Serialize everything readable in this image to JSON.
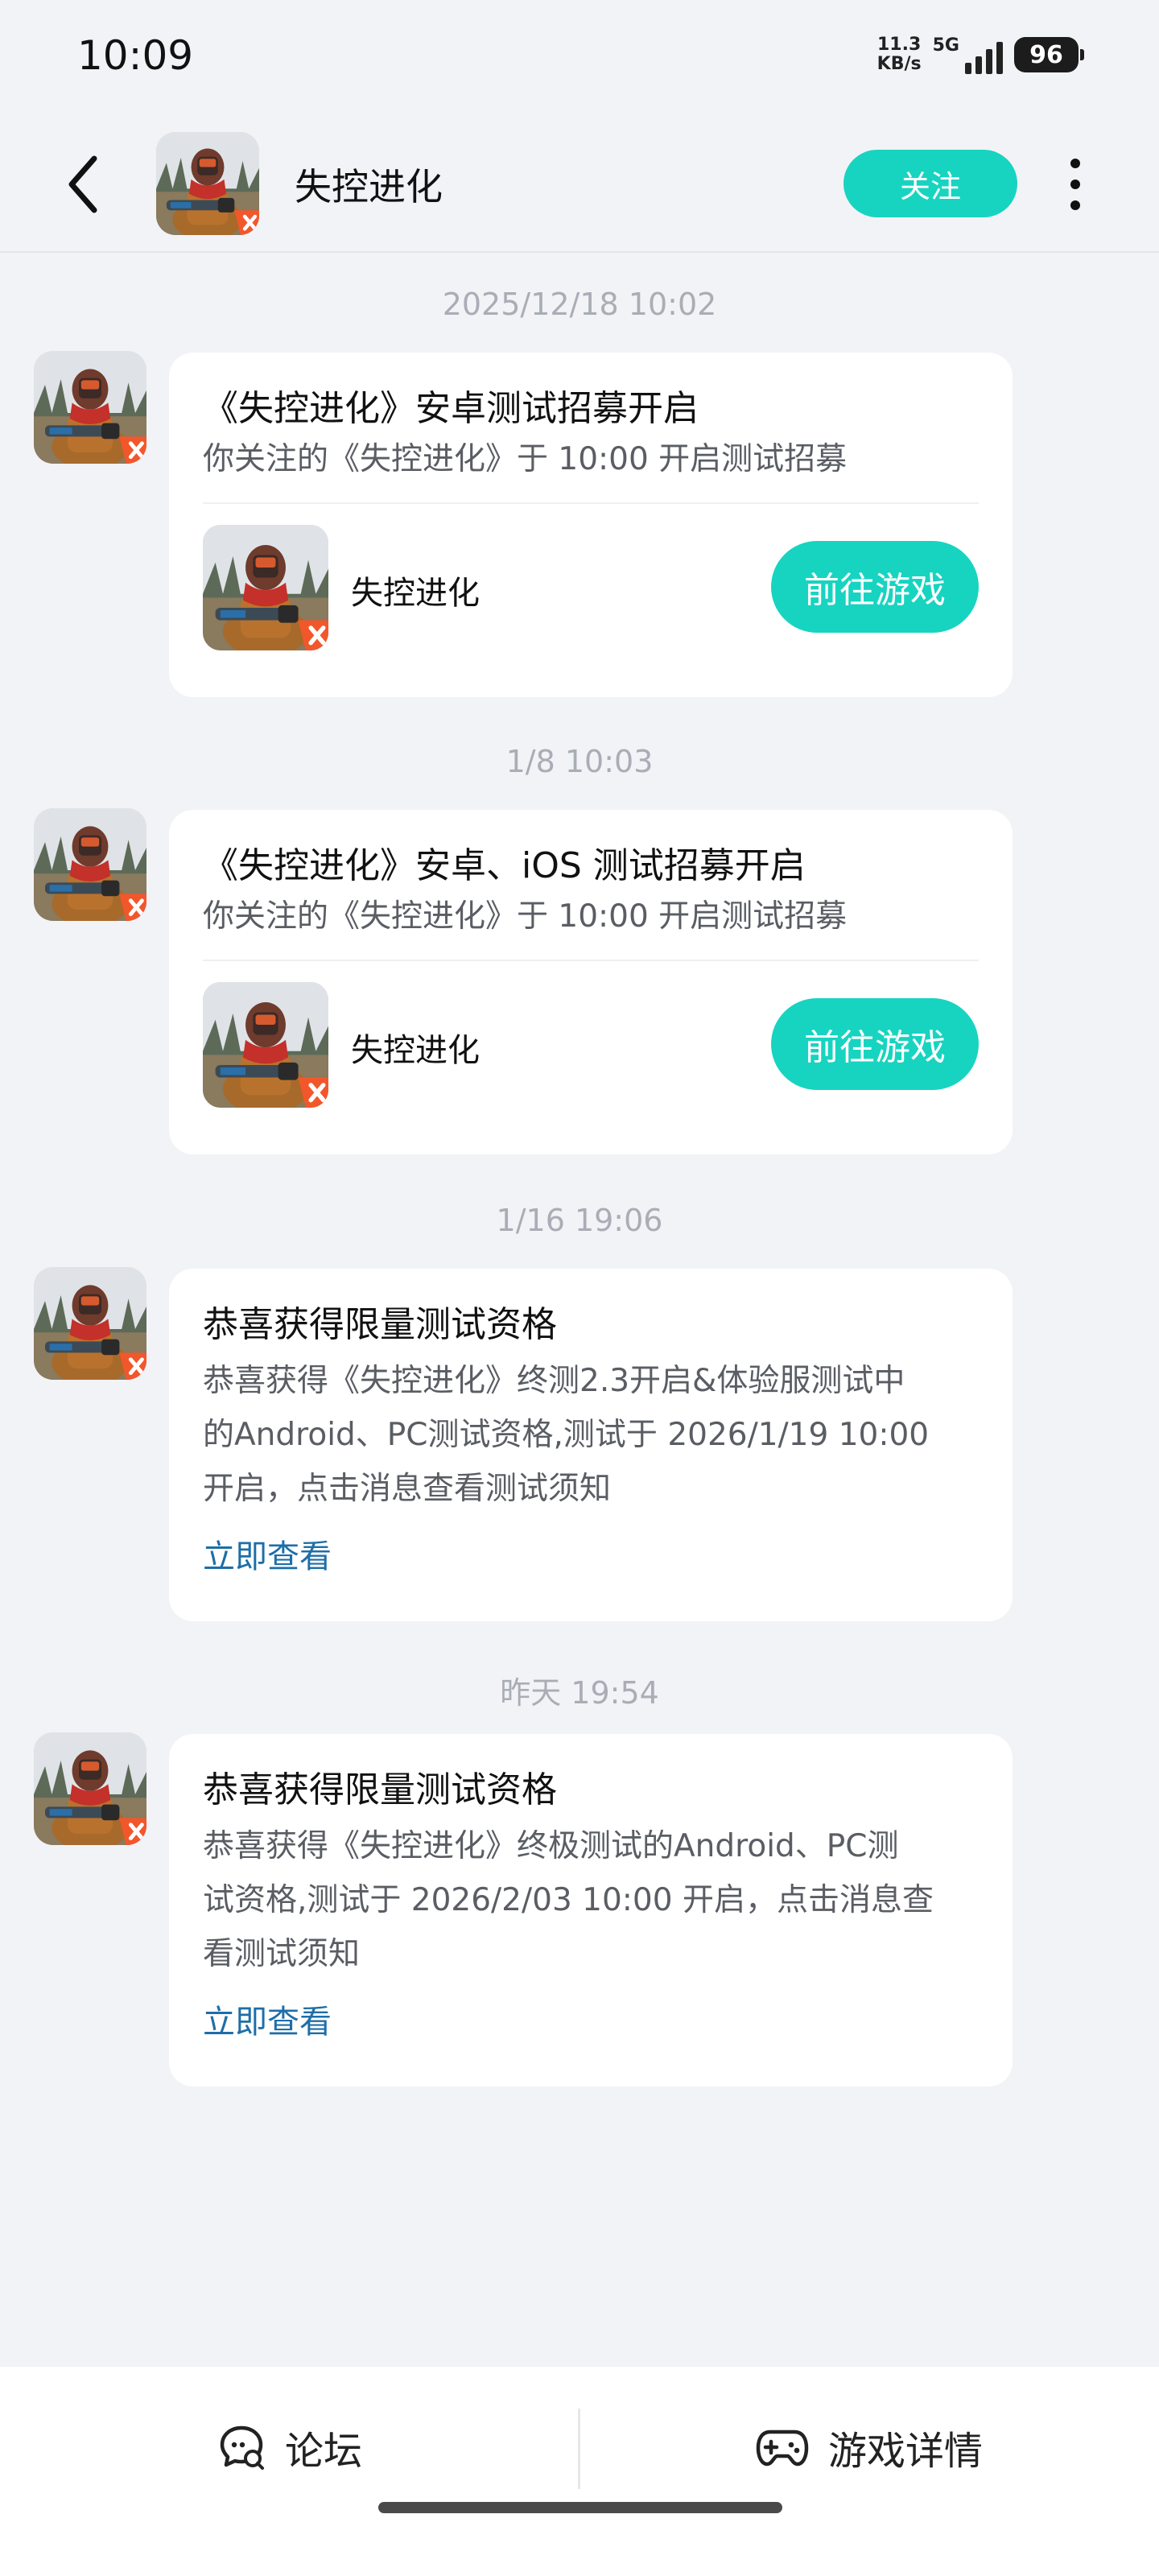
{
  "status_bar": {
    "time": "10:09",
    "net_speed_value": "11.3",
    "net_speed_unit": "KB/s",
    "network": "5G",
    "battery": "96"
  },
  "header": {
    "title": "失控进化",
    "follow_label": "关注",
    "icons": {
      "back": "chevron-left-icon",
      "more": "more-vertical-icon"
    }
  },
  "messages": [
    {
      "timestamp": "2025/12/18  10:02",
      "title": "《失控进化》安卓测试招募开启",
      "subtitle": "你关注的《失控进化》于 10:00 开启测试招募",
      "game_name": "失控进化",
      "action_label": "前往游戏"
    },
    {
      "timestamp": "1/8  10:03",
      "title": "《失控进化》安卓、iOS 测试招募开启",
      "subtitle": "你关注的《失控进化》于 10:00 开启测试招募",
      "game_name": "失控进化",
      "action_label": "前往游戏"
    },
    {
      "timestamp": "1/16  19:06",
      "title": "恭喜获得限量测试资格",
      "body_lines": [
        "恭喜获得《失控进化》终测2.3开启&体验服测试中",
        "的Android、PC测试资格,测试于 2026/1/19 10:00",
        "开启，点击消息查看测试须知"
      ],
      "link_label": "立即查看"
    },
    {
      "timestamp": "昨天  19:54",
      "title": "恭喜获得限量测试资格",
      "body_lines": [
        "恭喜获得《失控进化》终极测试的Android、PC测",
        "试资格,测试于 2026/2/03 10:00 开启，点击消息查",
        "看测试须知"
      ],
      "link_label": "立即查看"
    }
  ],
  "bottom_bar": {
    "forum_label": "论坛",
    "details_label": "游戏详情",
    "icons": {
      "forum": "chat-bubble-icon",
      "details": "gamepad-icon"
    }
  },
  "colors": {
    "accent": "#17d4c0",
    "link": "#1d6ea8",
    "background": "#f2f3f7",
    "timestamp": "#a9adb5"
  }
}
